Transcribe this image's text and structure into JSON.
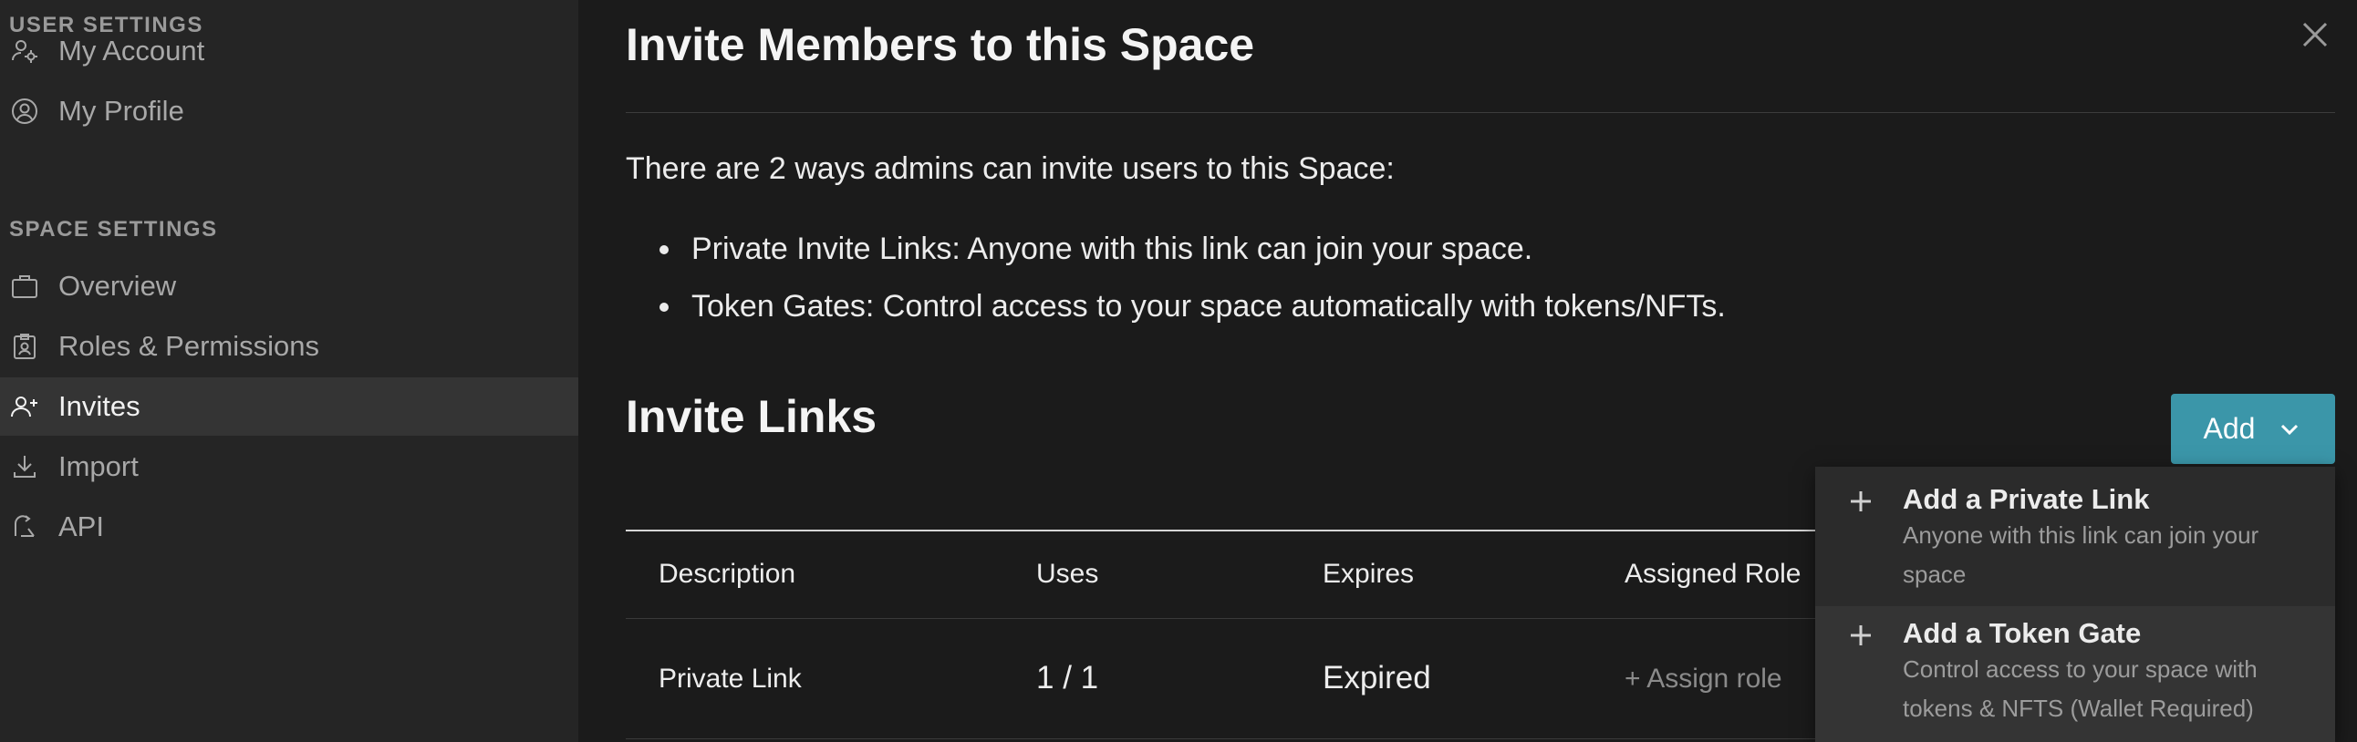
{
  "sidebar": {
    "user_settings_label": "USER SETTINGS",
    "space_settings_label": "SPACE SETTINGS",
    "user_items": [
      {
        "label": "My Account",
        "icon": "user-gear-icon"
      },
      {
        "label": "My Profile",
        "icon": "user-circle-icon"
      }
    ],
    "space_items": [
      {
        "label": "Overview",
        "icon": "briefcase-icon"
      },
      {
        "label": "Roles & Permissions",
        "icon": "badge-icon"
      },
      {
        "label": "Invites",
        "icon": "user-plus-icon",
        "active": true
      },
      {
        "label": "Import",
        "icon": "download-icon"
      },
      {
        "label": "API",
        "icon": "api-icon"
      }
    ]
  },
  "main": {
    "title": "Invite Members to this Space",
    "intro": "There are 2 ways admins can invite users to this Space:",
    "bullets": [
      "Private Invite Links: Anyone with this link can join your space.",
      "Token Gates: Control access to your space automatically with tokens/NFTs."
    ],
    "invite_links_title": "Invite Links",
    "add_button_label": "Add",
    "table": {
      "headers": [
        "Description",
        "Uses",
        "Expires",
        "Assigned Role"
      ],
      "rows": [
        {
          "description": "Private Link",
          "uses": "1 / 1",
          "expires": "Expired",
          "role": "+ Assign role"
        }
      ]
    },
    "dropdown": {
      "items": [
        {
          "title": "Add a Private Link",
          "description": "Anyone with this link can join your space"
        },
        {
          "title": "Add a Token Gate",
          "description": "Control access to your space with tokens & NFTS (Wallet Required)"
        }
      ]
    }
  },
  "colors": {
    "accent": "#3b96a9",
    "sidebar_bg": "#252525",
    "main_bg": "#1b1b1b"
  }
}
